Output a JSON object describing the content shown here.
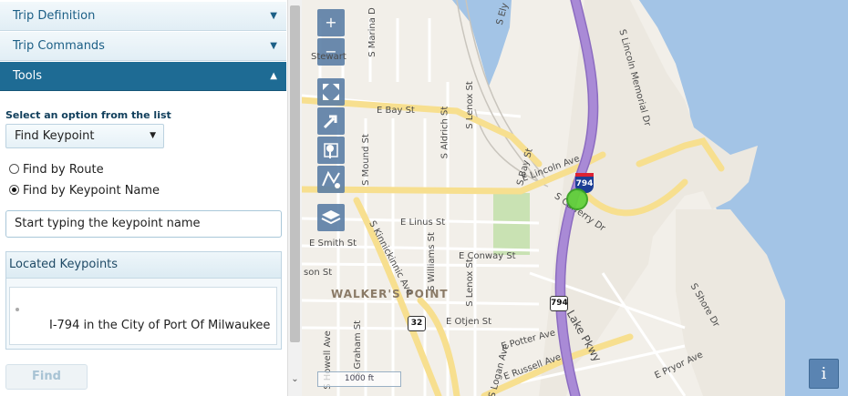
{
  "panel": {
    "sections": {
      "trip_definition": "Trip Definition",
      "trip_commands": "Trip Commands",
      "tools": "Tools"
    },
    "arrows": {
      "collapsed": "▼",
      "expanded": "▲"
    },
    "select_label": "Select an option from the list",
    "dropdown": {
      "selected": "Find Keypoint",
      "caret": "▼"
    },
    "radios": [
      {
        "label": "Find by Route",
        "checked": false
      },
      {
        "label": "Find by Keypoint Name",
        "checked": true
      }
    ],
    "search": {
      "value": "Start typing the keypoint name"
    },
    "located": {
      "header": "Located Keypoints",
      "items": [
        "I-794 in the City of Port Of Milwaukee"
      ]
    },
    "find_button": "Find"
  },
  "map": {
    "controls": {
      "zoom_in": "+",
      "zoom_out": "−",
      "info": "i"
    },
    "scale_label": "1000 ft",
    "labels": {
      "stewart": "Stewart",
      "e_bay_st": "E Bay St",
      "s_marina": "S Marina D",
      "s_lincoln_memorial": "S Lincoln Memorial Dr",
      "e_lincoln_ave": "E Lincoln Ave",
      "s_carferry": "S Carferry Dr",
      "e_linus": "E Linus St",
      "e_smith": "E Smith St",
      "e_conway": "E Conway St",
      "son_st": "son St",
      "walkers_point": "WALKER'S POINT",
      "e_otjen": "E Otjen St",
      "e_potter": "E Potter Ave",
      "e_russell": "E Russell Ave",
      "lake_pkwy": "Lake Pkwy",
      "s_shore": "S Shore Dr",
      "e_pryor": "E Pryor Ave",
      "kinnickinnic": "S Kinnickinnic Ave",
      "s_mound": "S Mound St",
      "s_aldrich": "S Aldrich St",
      "s_lenox_top": "S Lenox St",
      "s_lenox": "S Lenox St",
      "s_williams": "S Williams St",
      "s_graham": "S Graham St",
      "s_howell": "S Howell Ave",
      "s_logan": "S Logan Ave",
      "s_bay": "S Bay St",
      "s_ely": "S Ely"
    },
    "shields": {
      "i794": "794",
      "hwy794": "794",
      "hwy32": "32"
    },
    "colors": {
      "water": "#a3c4e6",
      "highway": "#a98ad6",
      "major_road": "#f7df8f",
      "park": "#c9e2b3",
      "marker": "#62d13a"
    }
  }
}
